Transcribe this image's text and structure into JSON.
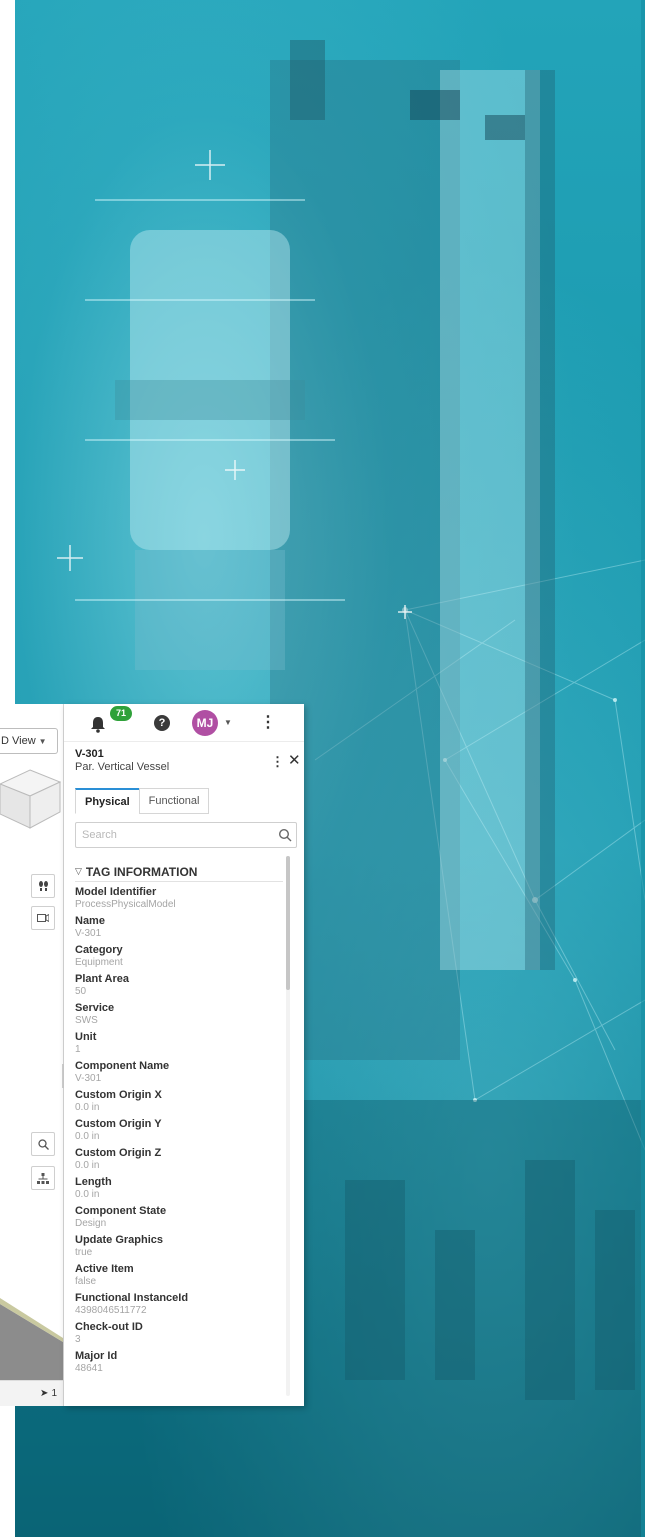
{
  "viewer": {
    "view_select_label": "D View",
    "status_count": "1"
  },
  "topbar": {
    "notification_count": "71",
    "help_label": "?",
    "avatar_initials": "MJ"
  },
  "item": {
    "title": "V-301",
    "subtitle": "Par. Vertical Vessel"
  },
  "tabs": [
    {
      "label": "Physical",
      "active": true
    },
    {
      "label": "Functional",
      "active": false
    }
  ],
  "search": {
    "placeholder": "Search",
    "value": ""
  },
  "section": {
    "title": "TAG INFORMATION"
  },
  "properties": [
    {
      "label": "Model Identifier",
      "value": "ProcessPhysicalModel"
    },
    {
      "label": "Name",
      "value": "V-301"
    },
    {
      "label": "Category",
      "value": "Equipment"
    },
    {
      "label": "Plant Area",
      "value": "50"
    },
    {
      "label": "Service",
      "value": "SWS"
    },
    {
      "label": "Unit",
      "value": "1"
    },
    {
      "label": "Component Name",
      "value": "V-301"
    },
    {
      "label": "Custom Origin X",
      "value": "0.0 in"
    },
    {
      "label": "Custom Origin Y",
      "value": "0.0 in"
    },
    {
      "label": "Custom Origin Z",
      "value": "0.0 in"
    },
    {
      "label": "Length",
      "value": "0.0 in"
    },
    {
      "label": "Component State",
      "value": "Design"
    },
    {
      "label": "Update Graphics",
      "value": "true"
    },
    {
      "label": "Active Item",
      "value": "false"
    },
    {
      "label": "Functional InstanceId",
      "value": "4398046511772"
    },
    {
      "label": "Check-out ID",
      "value": "3"
    },
    {
      "label": "Major Id",
      "value": "48641"
    }
  ],
  "colors": {
    "background": "#1a97ad",
    "badge": "#2fa13a",
    "avatar": "#b04fa3",
    "active_tab": "#2a8fd6"
  }
}
